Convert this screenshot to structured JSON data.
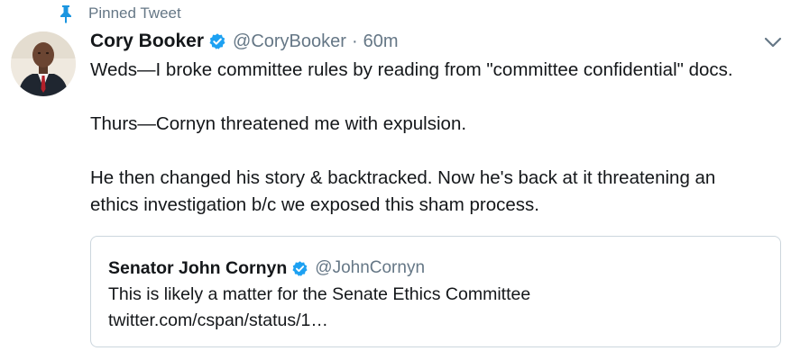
{
  "pinned": {
    "label": "Pinned Tweet",
    "icon": "pin-icon",
    "color": "#1b95e0"
  },
  "tweet": {
    "author": {
      "name": "Cory Booker",
      "handle": "@CoryBooker",
      "verified": true,
      "avatar_icon": "avatar"
    },
    "separator": "·",
    "timestamp": "60m",
    "menu_icon": "chevron-down-icon",
    "text_lines": [
      "Weds—I broke committee rules by reading from \"committee confidential\" docs.",
      "Thurs—Cornyn threatened me with expulsion.",
      "He then changed his story & backtracked. Now he's back at it threatening an",
      "ethics investigation b/c we exposed this sham process."
    ]
  },
  "quoted_tweet": {
    "author": {
      "name": "Senator John Cornyn",
      "handle": "@JohnCornyn",
      "verified": true
    },
    "text": "This is likely a matter for the Senate Ethics Committee",
    "link": "twitter.com/cspan/status/1…"
  },
  "colors": {
    "verified_blue": "#1da1f2",
    "secondary_text": "#657786",
    "border": "#ccd6dd",
    "primary_text": "#14171a"
  }
}
